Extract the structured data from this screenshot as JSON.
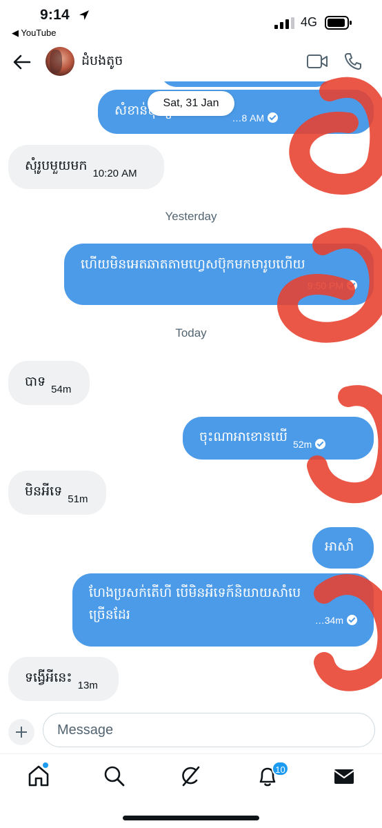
{
  "status_bar": {
    "time": "9:14",
    "back_app": "◀ YouTube",
    "network": "4G",
    "location_icon": "location-arrow-icon",
    "signal_icon": "signal-bars-icon",
    "battery_icon": "battery-icon"
  },
  "header": {
    "contact_name": "ដំបងតូច",
    "back_icon": "arrow-left-icon",
    "video_icon": "video-call-icon",
    "phone_icon": "phone-call-icon"
  },
  "floating_date": "Sat, 31 Jan",
  "separators": {
    "yesterday": "Yesterday",
    "today": "Today"
  },
  "messages": [
    {
      "id": "m1",
      "direction": "out",
      "text": "សំខាន់ប៉ុនឿមកអេតទៅ",
      "time": "…8 AM",
      "read": true
    },
    {
      "id": "m2",
      "direction": "in",
      "text": "សុំរូបមួយមក",
      "time": "10:20 AM"
    },
    {
      "id": "m3",
      "direction": "out",
      "text": "ហើយមិនអេតឆាតតាមហ្វេសប៊ុកមកមារូបហើយ",
      "time": "9:50 PM",
      "read": true
    },
    {
      "id": "m4",
      "direction": "in",
      "text": "បាទ",
      "time": "54m"
    },
    {
      "id": "m5",
      "direction": "out",
      "text": "ចុះណាអាខោនយើ",
      "time": "52m",
      "read": true
    },
    {
      "id": "m6",
      "direction": "in",
      "text": "មិនអីទេ",
      "time": "51m"
    },
    {
      "id": "m7",
      "direction": "out",
      "text": "អាសាំ",
      "time": "",
      "read": false
    },
    {
      "id": "m8",
      "direction": "out",
      "text_line1": "ហែងប្រសក់តើហី បើមិនអីទេក៍និយាយសាំបេ",
      "text_line2": "ច្រើនដែរ",
      "time": "…34m",
      "read": true
    },
    {
      "id": "m9",
      "direction": "in",
      "text": "ទង្វើអីនេះ",
      "time": "13m"
    }
  ],
  "composer": {
    "placeholder": "Message",
    "value": "",
    "add_icon": "plus-icon"
  },
  "tabbar": {
    "items": [
      {
        "name": "home",
        "icon": "home-icon",
        "has_dot": true
      },
      {
        "name": "search",
        "icon": "search-icon"
      },
      {
        "name": "grok",
        "icon": "grok-icon"
      },
      {
        "name": "notifications",
        "icon": "bell-icon",
        "badge": "10"
      },
      {
        "name": "messages",
        "icon": "envelope-icon",
        "active": true
      }
    ]
  },
  "colors": {
    "outgoing_bubble": "#4c9be8",
    "incoming_bubble": "#eff1f3",
    "accent": "#1d9bf0",
    "scribble": "#e8402e"
  }
}
